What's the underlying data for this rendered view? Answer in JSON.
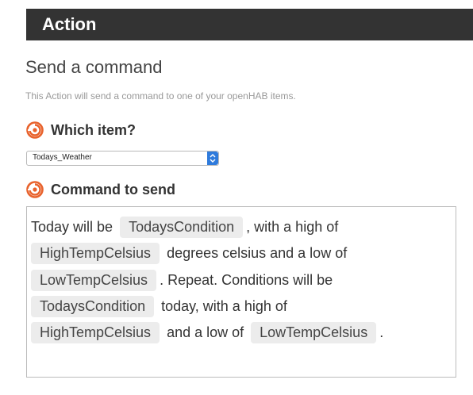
{
  "header": {
    "title": "Action"
  },
  "page": {
    "title": "Send a command",
    "description": "This Action will send a command to one of your openHAB items."
  },
  "item_field": {
    "label": "Which item?",
    "icon": "openhab-logo-icon",
    "selected_value": "Todays_Weather"
  },
  "command_field": {
    "label": "Command to send",
    "icon": "openhab-logo-icon",
    "lines": [
      [
        {
          "type": "text",
          "value": "Today will be "
        },
        {
          "type": "chip",
          "value": "TodaysCondition"
        },
        {
          "type": "text",
          "value": ", with a high of"
        }
      ],
      [
        {
          "type": "chip",
          "value": "HighTempCelsius"
        },
        {
          "type": "text",
          "value": " degrees celsius and a low of"
        }
      ],
      [
        {
          "type": "chip",
          "value": "LowTempCelsius"
        },
        {
          "type": "text",
          "value": ". Repeat. Conditions will be"
        }
      ],
      [
        {
          "type": "chip",
          "value": "TodaysCondition"
        },
        {
          "type": "text",
          "value": " today, with a high of"
        }
      ],
      [
        {
          "type": "chip",
          "value": "HighTempCelsius"
        },
        {
          "type": "text",
          "value": " and a low of "
        },
        {
          "type": "chip",
          "value": "LowTempCelsius"
        },
        {
          "type": "text",
          "value": "."
        }
      ]
    ]
  },
  "colors": {
    "header_bg": "#333333",
    "select_arrow": "#2f7bdc",
    "icon_orange": "#e8622c",
    "chip_bg": "#ececec"
  }
}
